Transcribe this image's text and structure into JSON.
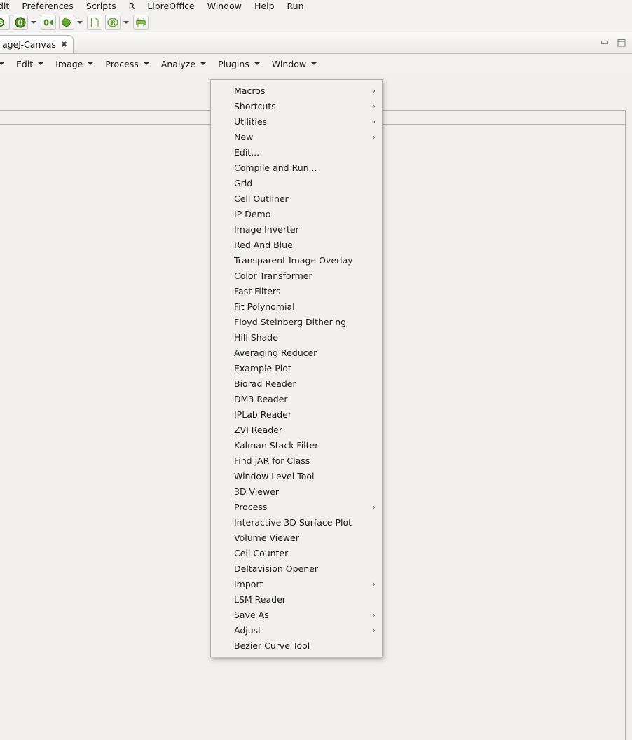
{
  "app_menubar": {
    "items": [
      {
        "label": "dit",
        "truncated": true
      },
      {
        "label": "Preferences"
      },
      {
        "label": "Scripts"
      },
      {
        "label": "R"
      },
      {
        "label": "LibreOffice"
      },
      {
        "label": "Window"
      },
      {
        "label": "Help"
      },
      {
        "label": "Run"
      }
    ]
  },
  "toolbar": {
    "buttons": [
      {
        "name": "partial-button",
        "icon": "green-partial-icon"
      },
      {
        "name": "zero-circle-button",
        "icon": "zero-circle-icon"
      },
      {
        "name": "zero-circle-dropdown",
        "icon": "chevron-down-icon"
      },
      {
        "name": "zero-run-button",
        "icon": "zero-run-icon"
      },
      {
        "name": "rserve-button",
        "icon": "green-puzzle-icon"
      },
      {
        "name": "rserve-dropdown",
        "icon": "chevron-down-icon"
      },
      {
        "name": "new-document-button",
        "icon": "new-document-icon"
      },
      {
        "name": "r-console-button",
        "icon": "r-circle-icon"
      },
      {
        "name": "r-console-dropdown",
        "icon": "chevron-down-icon"
      },
      {
        "name": "print-button",
        "icon": "printer-icon"
      }
    ]
  },
  "editor": {
    "tab": {
      "label": "ageJ-Canvas",
      "close_glyph": "✖"
    },
    "window_controls": {
      "minimize": "minimize-icon",
      "maximize": "maximize-icon"
    },
    "menubar": {
      "items": [
        {
          "label": "",
          "truncated": true
        },
        {
          "label": "Edit"
        },
        {
          "label": "Image"
        },
        {
          "label": "Process"
        },
        {
          "label": "Analyze"
        },
        {
          "label": "Plugins",
          "active": true
        },
        {
          "label": "Window"
        }
      ]
    }
  },
  "plugins_menu": {
    "items": [
      {
        "label": "Macros",
        "submenu": true
      },
      {
        "label": "Shortcuts",
        "submenu": true
      },
      {
        "label": "Utilities",
        "submenu": true
      },
      {
        "label": "New",
        "submenu": true
      },
      {
        "label": "Edit...",
        "submenu": false
      },
      {
        "label": "Compile and Run...",
        "submenu": false
      },
      {
        "label": "Grid",
        "submenu": false
      },
      {
        "label": "Cell Outliner",
        "submenu": false
      },
      {
        "label": "IP Demo",
        "submenu": false
      },
      {
        "label": "Image Inverter",
        "submenu": false
      },
      {
        "label": "Red And Blue",
        "submenu": false
      },
      {
        "label": "Transparent Image Overlay",
        "submenu": false
      },
      {
        "label": "Color Transformer",
        "submenu": false
      },
      {
        "label": "Fast Filters",
        "submenu": false
      },
      {
        "label": "Fit Polynomial",
        "submenu": false
      },
      {
        "label": "Floyd Steinberg Dithering",
        "submenu": false
      },
      {
        "label": "Hill Shade",
        "submenu": false
      },
      {
        "label": "Averaging Reducer",
        "submenu": false
      },
      {
        "label": "Example Plot",
        "submenu": false
      },
      {
        "label": "Biorad Reader",
        "submenu": false
      },
      {
        "label": "DM3 Reader",
        "submenu": false
      },
      {
        "label": "IPLab Reader",
        "submenu": false
      },
      {
        "label": "ZVI Reader",
        "submenu": false
      },
      {
        "label": "Kalman Stack Filter",
        "submenu": false
      },
      {
        "label": "Find JAR for Class",
        "submenu": false
      },
      {
        "label": "Window Level Tool",
        "submenu": false
      },
      {
        "label": "3D Viewer",
        "submenu": false
      },
      {
        "label": "Process",
        "submenu": true
      },
      {
        "label": "Interactive 3D Surface Plot",
        "submenu": false
      },
      {
        "label": "Volume Viewer",
        "submenu": false
      },
      {
        "label": "Cell Counter",
        "submenu": false
      },
      {
        "label": "Deltavision Opener",
        "submenu": false
      },
      {
        "label": "Import",
        "submenu": true
      },
      {
        "label": "LSM Reader",
        "submenu": false
      },
      {
        "label": "Save As",
        "submenu": true
      },
      {
        "label": "Adjust",
        "submenu": true
      },
      {
        "label": "Bezier Curve Tool",
        "submenu": false
      }
    ],
    "submenu_glyph": "›"
  },
  "colors": {
    "menu_background": "#f1f0ee",
    "menu_border": "#b3b1ae",
    "toolbar_background": "#f2f1f0",
    "accent_green": "#4f9223",
    "text": "#1c1c1c"
  }
}
